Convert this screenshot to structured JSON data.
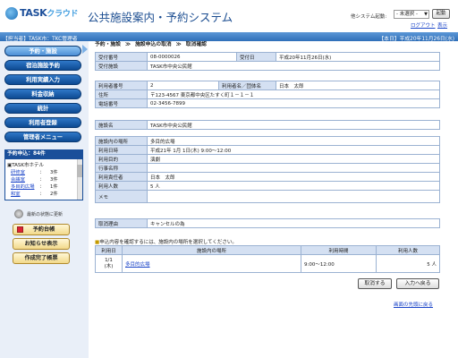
{
  "header": {
    "logo_text": "TASK",
    "logo_kana": "クラウド",
    "app_title": "公共施設案内・予約システム",
    "other_system_label": "他システム起動:",
    "other_system_value": "- 未選択 -",
    "launch_button": "起動",
    "logout_link": "ログアウト",
    "mypage_link": "表示"
  },
  "info_bar": {
    "user_info": "【担当者】TASK市：TKC管理者",
    "today": "【本日】平成20年11月26日(水)"
  },
  "sidebar": {
    "menu": [
      {
        "label": "予約・施設",
        "active": true
      },
      {
        "label": "宿泊施設予約",
        "active": false
      },
      {
        "label": "利用実績入力",
        "active": false
      },
      {
        "label": "料金収納",
        "active": false
      },
      {
        "label": "統計",
        "active": false
      },
      {
        "label": "利用者登録",
        "active": false
      },
      {
        "label": "管理者メニュー",
        "active": false
      }
    ],
    "bookings_header": "予約申込：84件",
    "facility": "▣TASK市ホテル",
    "bookings": [
      {
        "name": "研修室",
        "count": "3件"
      },
      {
        "name": "会議室",
        "count": "3件"
      },
      {
        "name": "多目的広場",
        "count": "1件"
      },
      {
        "name": "和室",
        "count": "2件"
      }
    ],
    "refresh_label": "最新の状態に更新",
    "buttons": [
      "予約台帳",
      "お知らせ表示",
      "作成完了帳票"
    ]
  },
  "breadcrumb": [
    "予約・施設",
    "施設申込の取消",
    "取消確認"
  ],
  "form": {
    "receipt_no_label": "受付番号",
    "receipt_no": "08-0000026",
    "receipt_date_label": "受付日",
    "receipt_date": "平成20年11月26日(水)",
    "receipt_facility_label": "受付施設",
    "receipt_facility": "TASK市中央公民館",
    "user_no_label": "利用者番号",
    "user_no": "2",
    "user_name_label": "利用者名／団体名",
    "user_name": "日本　太郎",
    "address_label": "住所",
    "address": "〒123-4567  東京都中央区たすく町１－１－１",
    "phone_label": "電話番号",
    "phone": "02-3456-7899",
    "facility_label": "施設名",
    "facility": "TASK市中央公民館",
    "place_label": "施設内の場所",
    "place": "多目的広場",
    "datetime_label": "利用日時",
    "datetime": "平成21年 1月 1日(木)  9:00～12:00",
    "purpose_label": "利用目的",
    "purpose": "演劇",
    "event_label": "行事名称",
    "event": "",
    "responsible_label": "利用責任者",
    "responsible": "日本　太郎",
    "count_label": "利用人数",
    "count": "5 人",
    "memo_label": "メモ",
    "memo": "",
    "reason_label": "取消理由",
    "reason": "キャンセルの為"
  },
  "list": {
    "instruction": "申込内容を確認するには、施設内の場所を選択してください。",
    "headers": [
      "利用日",
      "施設内の場所",
      "利用時間",
      "利用人数"
    ],
    "rows": [
      {
        "date_line1": "1/1",
        "date_line2": "(木)",
        "place": "多目的広場",
        "time": "9:00～12:00",
        "count": "5 人"
      }
    ]
  },
  "actions": {
    "cancel_button": "取消する",
    "back_button": "入力へ戻る",
    "back_to_top": "画面の先頭に戻る"
  }
}
